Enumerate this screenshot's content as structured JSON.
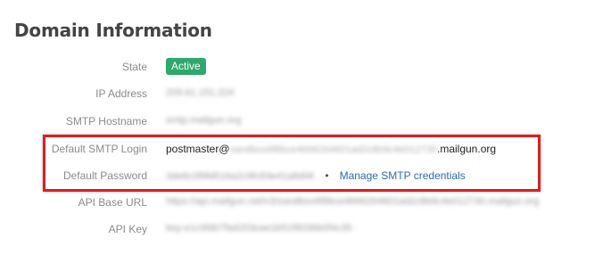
{
  "section": {
    "title": "Domain Information"
  },
  "rows": {
    "state": {
      "label": "State",
      "value": "Active"
    },
    "ip_address": {
      "label": "IP Address",
      "value": "209.61.151.224"
    },
    "smtp_hostname": {
      "label": "SMTP Hostname",
      "value": "smtp.mailgun.org"
    },
    "default_smtp_login": {
      "label": "Default SMTP Login",
      "prefix": "postmaster@",
      "masked": "sandbox6f8bce4666264601ad2c8b9c4e012730",
      "suffix": ".mailgun.org"
    },
    "default_password": {
      "label": "Default Password",
      "masked": "3de8c0f9fd516a2c9fc83e41a8d06",
      "bullet": "•",
      "link": "Manage SMTP credentials"
    },
    "api_base_url": {
      "label": "API Base URL",
      "value": "https://api.mailgun.net/v3/sandbox6f8bce4666264601ad2c8b9c4e012730.mailgun.org"
    },
    "api_key": {
      "label": "API Key",
      "value": "key-e1c9fd07fa4203cee1b51f8036b0f4c35"
    }
  },
  "colors": {
    "active_badge": "#2ea86b",
    "highlight_border": "#d92020",
    "link": "#2a6bb3"
  }
}
